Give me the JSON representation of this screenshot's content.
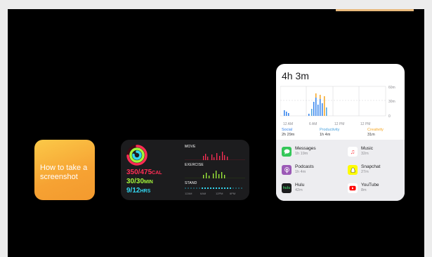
{
  "tip_widget": {
    "title": "How to take a screenshot"
  },
  "activity_widget": {
    "move": "350/475",
    "move_unit": "CAL",
    "exercise": "30/30",
    "exercise_unit": "MIN",
    "stand": "9/12",
    "stand_unit": "HRS",
    "labels": {
      "move": "MOVE",
      "exercise": "EXERCISE",
      "stand": "STAND"
    },
    "time_ticks": [
      "12AM",
      "6AM",
      "12PM",
      "6PM"
    ],
    "colors": {
      "move": "#ff2d55",
      "exercise": "#a3f53b",
      "stand": "#33d7f0"
    }
  },
  "screen_time_widget": {
    "total": "4h 3m",
    "y_ticks": [
      "60m",
      "30m",
      "0"
    ],
    "x_ticks": [
      "12 AM",
      "6 AM",
      "12 PM",
      "12 PM"
    ],
    "categories": [
      {
        "name": "Social",
        "value": "2h 29m",
        "color": "#2f80ed"
      },
      {
        "name": "Productivity",
        "value": "1h 4m",
        "color": "#4aa3df"
      },
      {
        "name": "Creativity",
        "value": "31m",
        "color": "#f5a623"
      }
    ],
    "apps": [
      {
        "name": "Messages",
        "time": "1h 19m",
        "icon": "messages-icon",
        "color": "#34c759"
      },
      {
        "name": "Music",
        "time": "32m",
        "icon": "music-icon",
        "color": "#ffffff"
      },
      {
        "name": "Podcasts",
        "time": "1h 4m",
        "icon": "podcasts-icon",
        "color": "#9b59b6"
      },
      {
        "name": "Snapchat",
        "time": "27m",
        "icon": "snapchat-icon",
        "color": "#fffc00"
      },
      {
        "name": "Hulu",
        "time": "42m",
        "icon": "hulu-icon",
        "color": "#1c1c1e"
      },
      {
        "name": "YouTube",
        "time": "8m",
        "icon": "youtube-icon",
        "color": "#ff0000"
      }
    ]
  }
}
